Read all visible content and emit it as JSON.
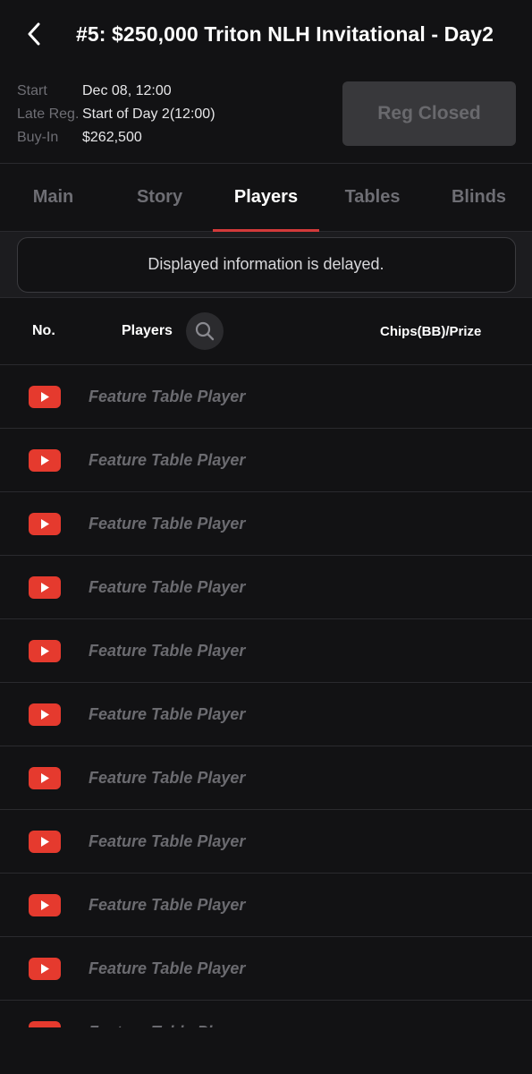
{
  "header": {
    "title": "#5: $250,000 Triton NLH Invitational - Day2"
  },
  "info": {
    "start_label": "Start",
    "start_value": "Dec 08, 12:00",
    "late_reg_label": "Late Reg.",
    "late_reg_value": "Start of Day 2(12:00)",
    "buyin_label": "Buy-In",
    "buyin_value": "$262,500",
    "reg_button": "Reg Closed"
  },
  "tabs": [
    {
      "label": "Main"
    },
    {
      "label": "Story"
    },
    {
      "label": "Players",
      "active": true
    },
    {
      "label": "Tables"
    },
    {
      "label": "Blinds"
    }
  ],
  "notice": "Displayed information is delayed.",
  "columns": {
    "no": "No.",
    "players": "Players",
    "chips": "Chips(BB)/Prize"
  },
  "rows": [
    {
      "name": "Feature Table Player"
    },
    {
      "name": "Feature Table Player"
    },
    {
      "name": "Feature Table Player"
    },
    {
      "name": "Feature Table Player"
    },
    {
      "name": "Feature Table Player"
    },
    {
      "name": "Feature Table Player"
    },
    {
      "name": "Feature Table Player"
    },
    {
      "name": "Feature Table Player"
    },
    {
      "name": "Feature Table Player"
    },
    {
      "name": "Feature Table Player"
    },
    {
      "name": "Feature Table Player"
    }
  ],
  "icons": {
    "back": "chevron-left-icon",
    "search": "search-icon",
    "video": "youtube-icon"
  },
  "colors": {
    "background": "#121214",
    "accent": "#d33a3a",
    "youtube_red": "#e53a2e"
  }
}
